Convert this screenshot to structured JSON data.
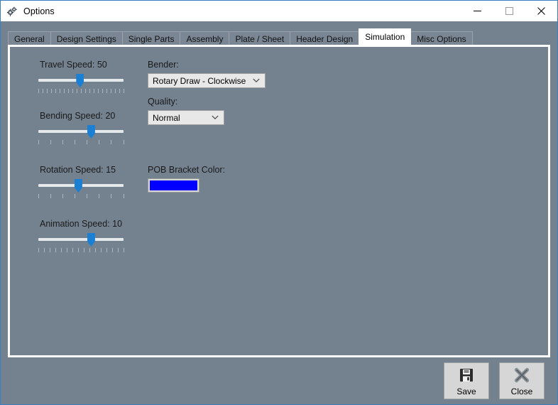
{
  "window": {
    "title": "Options",
    "icon": "gears-icon",
    "border_color": "#3a7ebf",
    "background": "#74818f"
  },
  "caption_buttons": [
    {
      "name": "minimize-button",
      "icon": "minimize-icon",
      "label": "—"
    },
    {
      "name": "maximize-button",
      "icon": "maximize-icon",
      "label": "□"
    },
    {
      "name": "close-button",
      "icon": "close-icon",
      "label": "✕"
    }
  ],
  "tabs": [
    {
      "label": "General",
      "selected": false
    },
    {
      "label": "Design Settings",
      "selected": false
    },
    {
      "label": "Single Parts",
      "selected": false
    },
    {
      "label": "Assembly",
      "selected": false
    },
    {
      "label": "Plate / Sheet",
      "selected": false
    },
    {
      "label": "Header Design",
      "selected": false
    },
    {
      "label": "Simulation",
      "selected": true
    },
    {
      "label": "Misc Options",
      "selected": false
    }
  ],
  "sliders": [
    {
      "name": "travel-speed",
      "label": "Travel Speed: 50",
      "value": 50,
      "percent": 49,
      "tick_count": 21
    },
    {
      "name": "bending-speed",
      "label": "Bending Speed: 20",
      "value": 20,
      "percent": 62,
      "tick_count": 8
    },
    {
      "name": "rotation-speed",
      "label": "Rotation Speed: 15",
      "value": 15,
      "percent": 47,
      "tick_count": 8
    },
    {
      "name": "animation-speed",
      "label": "Animation Speed: 10",
      "value": 10,
      "percent": 62,
      "tick_count": 16
    }
  ],
  "bender": {
    "label": "Bender:",
    "value": "Rotary Draw - Clockwise",
    "arrow_icon": "chevron-down-icon"
  },
  "quality": {
    "label": "Quality:",
    "value": "Normal",
    "arrow_icon": "chevron-down-icon"
  },
  "pob_bracket_color": {
    "label": "POB Bracket Color:",
    "color": "#0000ff"
  },
  "footer": {
    "save": {
      "label": "Save",
      "icon": "floppy-disk-icon"
    },
    "close": {
      "label": "Close",
      "icon": "x-cross-icon"
    }
  }
}
